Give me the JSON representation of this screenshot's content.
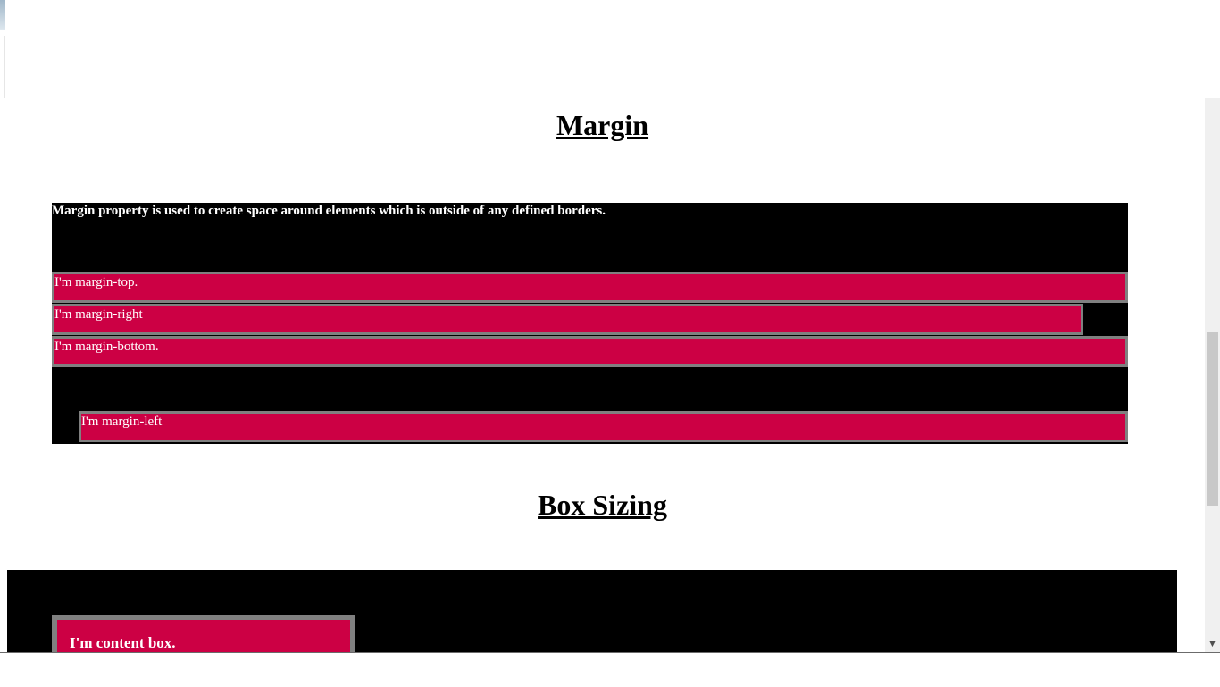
{
  "sections": {
    "margin": {
      "title": "Margin",
      "description": "Margin property is used to create space around elements which is outside of any defined borders.",
      "items": [
        {
          "label": "I'm margin-top."
        },
        {
          "label": "I'm margin-right"
        },
        {
          "label": "I'm margin-bottom."
        },
        {
          "label": "I'm margin-left"
        }
      ]
    },
    "box_sizing": {
      "title": "Box Sizing",
      "content_box_label": "I'm content box."
    }
  },
  "scrollbar": {
    "arrow_down": "▼"
  },
  "colors": {
    "box_background": "#000000",
    "item_background": "#cc0044",
    "item_border": "#808080",
    "text_light": "#ffffff"
  }
}
